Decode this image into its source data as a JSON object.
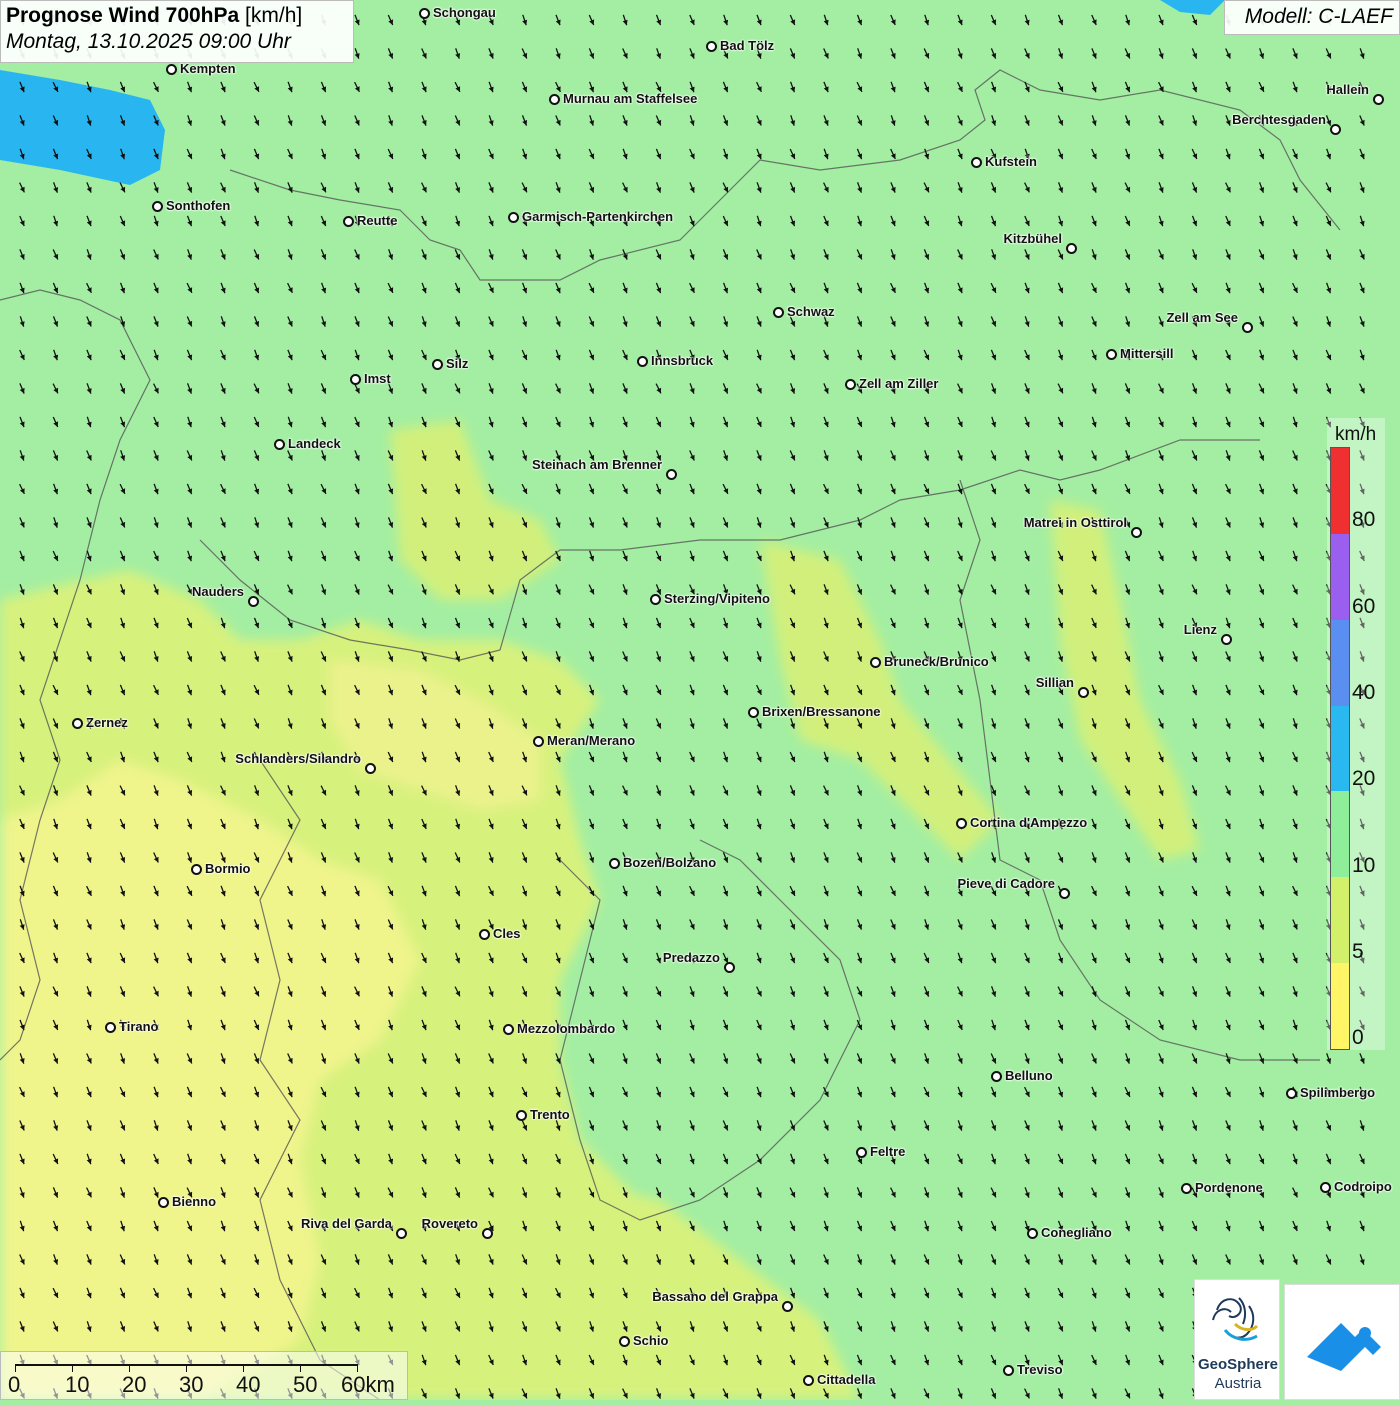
{
  "header": {
    "title_bold": "Prognose Wind 700hPa",
    "title_unit": "[km/h]",
    "datetime": "Montag, 13.10.2025 09:00 Uhr"
  },
  "model": "Modell: C-LAEF",
  "legend": {
    "unit": "km/h",
    "ticks": [
      "80",
      "60",
      "40",
      "20",
      "10",
      "5",
      "0"
    ],
    "colors": [
      "#f03030",
      "#9b5ff0",
      "#5a8ef0",
      "#2ab8f0",
      "#8fee9a",
      "#d2f06a",
      "#fff566"
    ]
  },
  "scale": {
    "labels": [
      "0",
      "10",
      "20",
      "30",
      "40",
      "50",
      "60km"
    ]
  },
  "logos": {
    "geosphere_line1": "GeoSphere",
    "geosphere_line2": "Austria"
  },
  "colors": {
    "calm_green": "#a3eea3",
    "light_wind_yellow": "#f6f58a",
    "lake_blue": "#29b6f0",
    "arrow": "#111111"
  },
  "wind_direction_note": "NNW",
  "cities": [
    {
      "name": "Schongau",
      "side": "right"
    },
    {
      "name": "Bad Tölz",
      "side": "right"
    },
    {
      "name": "Kempten",
      "side": "right"
    },
    {
      "name": "Murnau am Staffelsee",
      "side": "right"
    },
    {
      "name": "Hallein",
      "side": "left"
    },
    {
      "name": "Berchtesgaden",
      "side": "left"
    },
    {
      "name": "Kufstein",
      "side": "right"
    },
    {
      "name": "Sonthofen",
      "side": "right"
    },
    {
      "name": "Reutte",
      "side": "right"
    },
    {
      "name": "Garmisch-Partenkirchen",
      "side": "right"
    },
    {
      "name": "Kitzbühel",
      "side": "left"
    },
    {
      "name": "Schwaz",
      "side": "right"
    },
    {
      "name": "Zell am See",
      "side": "left"
    },
    {
      "name": "Mittersill",
      "side": "right"
    },
    {
      "name": "Innsbruck",
      "side": "right"
    },
    {
      "name": "Silz",
      "side": "right"
    },
    {
      "name": "Imst",
      "side": "right"
    },
    {
      "name": "Zell am Ziller",
      "side": "right"
    },
    {
      "name": "Landeck",
      "side": "right"
    },
    {
      "name": "Steinach am Brenner",
      "side": "left"
    },
    {
      "name": "Matrei in Osttirol",
      "side": "left"
    },
    {
      "name": "Nauders",
      "side": "left"
    },
    {
      "name": "Sterzing/Vipiteno",
      "side": "right"
    },
    {
      "name": "Lienz",
      "side": "left"
    },
    {
      "name": "Bruneck/Brunico",
      "side": "right"
    },
    {
      "name": "Sillian",
      "side": "left"
    },
    {
      "name": "Brixen/Bressanone",
      "side": "right"
    },
    {
      "name": "Zernez",
      "side": "right"
    },
    {
      "name": "Meran/Merano",
      "side": "right"
    },
    {
      "name": "Schlanders/Silandro",
      "side": "left"
    },
    {
      "name": "Cortina d'Ampezzo",
      "side": "right"
    },
    {
      "name": "Bozen/Bolzano",
      "side": "right"
    },
    {
      "name": "Bormio",
      "side": "right"
    },
    {
      "name": "Pieve di Cadore",
      "side": "left"
    },
    {
      "name": "Cles",
      "side": "right"
    },
    {
      "name": "Predazzo",
      "side": "left"
    },
    {
      "name": "Tirano",
      "side": "right"
    },
    {
      "name": "Mezzolombardo",
      "side": "right"
    },
    {
      "name": "Belluno",
      "side": "right"
    },
    {
      "name": "Spilimbergo",
      "side": "right"
    },
    {
      "name": "Trento",
      "side": "right"
    },
    {
      "name": "Feltre",
      "side": "right"
    },
    {
      "name": "Pordenone",
      "side": "right"
    },
    {
      "name": "Codroipo",
      "side": "right"
    },
    {
      "name": "Bienno",
      "side": "right"
    },
    {
      "name": "Riva del Garda",
      "side": "left"
    },
    {
      "name": "Rovereto",
      "side": "left"
    },
    {
      "name": "Conegliano",
      "side": "right"
    },
    {
      "name": "Bassano del Grappa",
      "side": "left"
    },
    {
      "name": "Schio",
      "side": "right"
    },
    {
      "name": "Treviso",
      "side": "right"
    },
    {
      "name": "Cittadella",
      "side": "right"
    }
  ]
}
